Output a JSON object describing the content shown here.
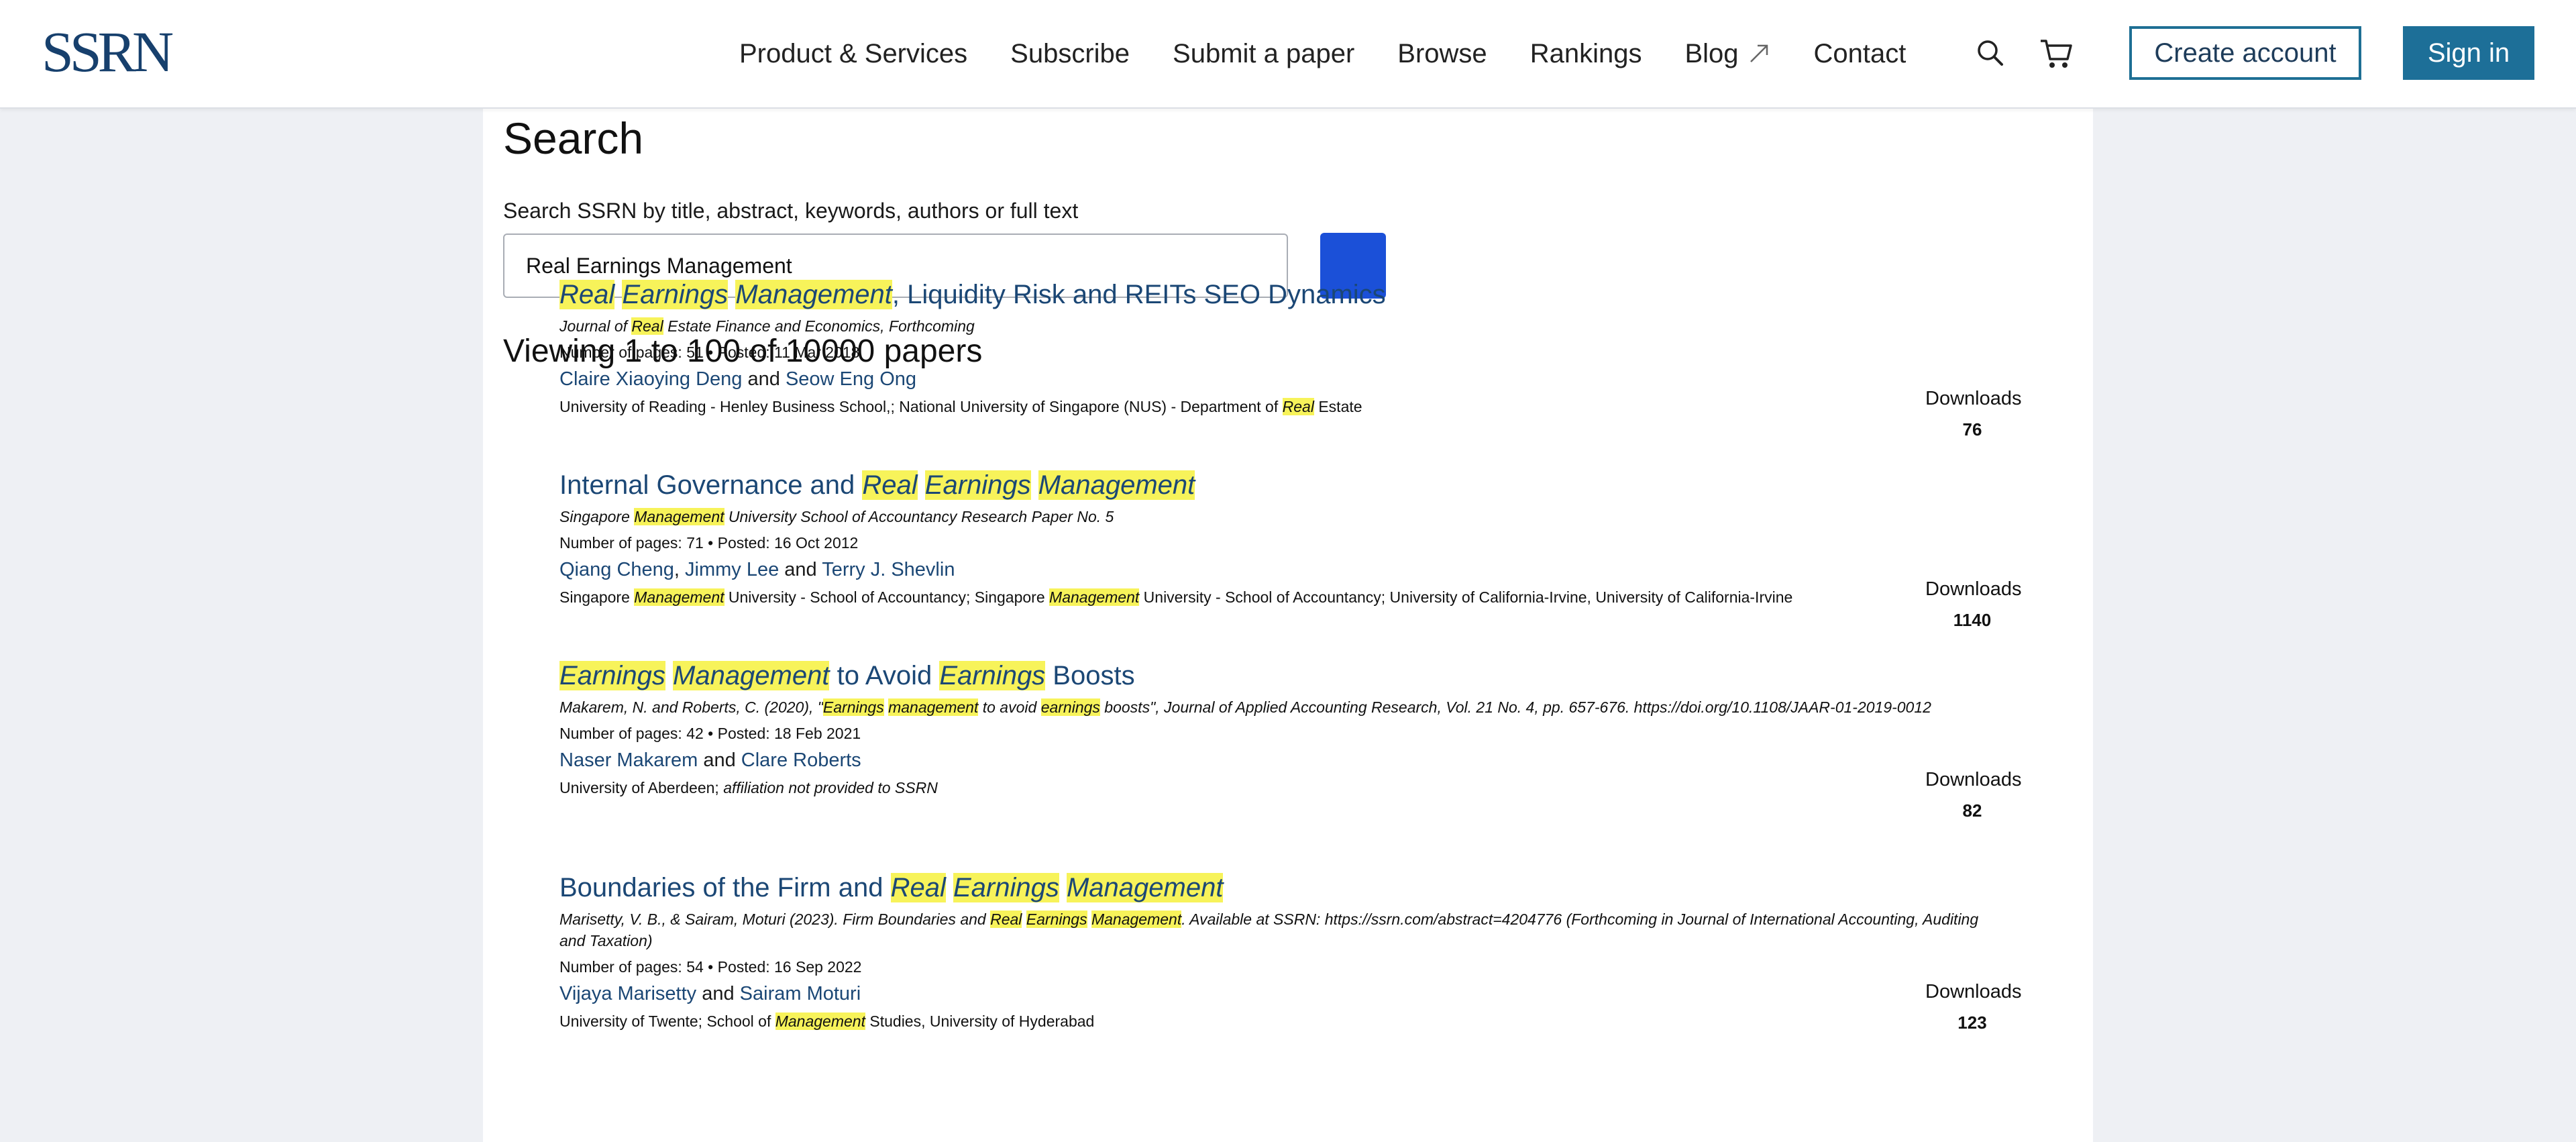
{
  "header": {
    "logo": "SSRN",
    "nav": [
      "Product & Services",
      "Subscribe",
      "Submit a paper",
      "Browse",
      "Rankings",
      "Blog",
      "Contact"
    ],
    "icons": {
      "blog_external": "external-arrow-icon",
      "search": "search-icon",
      "cart": "cart-icon"
    },
    "create_account": "Create account",
    "sign_in": "Sign in",
    "colors": {
      "brand": "#17406d",
      "accent": "#1d6f98"
    }
  },
  "search": {
    "title": "Search",
    "label": "Search SSRN by title, abstract, keywords, authors or full text",
    "value": "Real Earnings Management",
    "button_color": "#1b50d8"
  },
  "results_summary": "Viewing 1 to 100 of 10000 papers",
  "downloads_label": "Downloads",
  "highlight_color": "#f7f35a",
  "results": [
    {
      "title": [
        {
          "t": "Real",
          "h": true
        },
        {
          "t": " "
        },
        {
          "t": "Earnings",
          "h": true
        },
        {
          "t": " "
        },
        {
          "t": "Management",
          "h": true
        },
        {
          "t": ", Liquidity Risk and REITs SEO Dynamics"
        }
      ],
      "source": [
        {
          "t": "Journal of "
        },
        {
          "t": "Real",
          "h": true
        },
        {
          "t": " Estate Finance and Economics, Forthcoming"
        }
      ],
      "meta": "Number of pages: 51 • Posted: 11 Mar 2018",
      "authors": [
        "Claire Xiaoying Deng",
        "Seow Eng Ong"
      ],
      "affiliation": [
        {
          "t": "University of Reading - Henley Business School,; National University of Singapore (NUS) - Department of "
        },
        {
          "t": "Real",
          "h": true
        },
        {
          "t": " Estate"
        }
      ],
      "downloads": "76"
    },
    {
      "title": [
        {
          "t": "Internal Governance and "
        },
        {
          "t": "Real",
          "h": true
        },
        {
          "t": " "
        },
        {
          "t": "Earnings",
          "h": true
        },
        {
          "t": " "
        },
        {
          "t": "Management",
          "h": true
        }
      ],
      "source": [
        {
          "t": "Singapore "
        },
        {
          "t": "Management",
          "h": true
        },
        {
          "t": " University School of Accountancy Research Paper No. 5"
        }
      ],
      "meta": "Number of pages: 71 • Posted: 16 Oct 2012",
      "authors": [
        "Qiang Cheng",
        "Jimmy Lee",
        "Terry J. Shevlin"
      ],
      "affiliation": [
        {
          "t": "Singapore "
        },
        {
          "t": "Management",
          "h": true
        },
        {
          "t": " University - School of Accountancy; Singapore "
        },
        {
          "t": "Management",
          "h": true
        },
        {
          "t": " University - School of Accountancy; University of California-Irvine, University of California-Irvine"
        }
      ],
      "downloads": "1140"
    },
    {
      "title": [
        {
          "t": "Earnings",
          "h": true
        },
        {
          "t": " "
        },
        {
          "t": "Management",
          "h": true
        },
        {
          "t": " to Avoid "
        },
        {
          "t": "Earnings",
          "h": true
        },
        {
          "t": " Boosts"
        }
      ],
      "source": [
        {
          "t": "Makarem, N. and Roberts, C. (2020), \""
        },
        {
          "t": "Earnings",
          "h": true
        },
        {
          "t": " "
        },
        {
          "t": "management",
          "h": true
        },
        {
          "t": " to avoid "
        },
        {
          "t": "earnings",
          "h": true
        },
        {
          "t": " boosts\", Journal of Applied Accounting Research, Vol. 21 No. 4, pp. 657-676. https://doi.org/10.1108/JAAR-01-2019-0012"
        }
      ],
      "meta": "Number of pages: 42 • Posted: 18 Feb 2021",
      "authors": [
        "Naser Makarem",
        "Clare Roberts"
      ],
      "affiliation": [
        {
          "t": "University of Aberdeen; "
        },
        {
          "t": "affiliation not provided to SSRN",
          "i": true
        }
      ],
      "downloads": "82"
    },
    {
      "title": [
        {
          "t": "Boundaries of the Firm and "
        },
        {
          "t": "Real",
          "h": true
        },
        {
          "t": " "
        },
        {
          "t": "Earnings",
          "h": true
        },
        {
          "t": " "
        },
        {
          "t": "Management",
          "h": true
        }
      ],
      "source": [
        {
          "t": "Marisetty, V. B., & Sairam, Moturi (2023). Firm Boundaries and "
        },
        {
          "t": "Real",
          "h": true
        },
        {
          "t": " "
        },
        {
          "t": "Earnings",
          "h": true
        },
        {
          "t": " "
        },
        {
          "t": "Management",
          "h": true
        },
        {
          "t": ". Available at SSRN: https://ssrn.com/abstract=4204776 (Forthcoming in Journal of International Accounting, Auditing and Taxation)"
        }
      ],
      "meta": "Number of pages: 54 • Posted: 16 Sep 2022",
      "authors": [
        "Vijaya Marisetty",
        "Sairam Moturi"
      ],
      "affiliation": [
        {
          "t": "University of Twente; School of "
        },
        {
          "t": "Management",
          "h": true
        },
        {
          "t": " Studies, University of Hyderabad"
        }
      ],
      "downloads": "123"
    }
  ]
}
